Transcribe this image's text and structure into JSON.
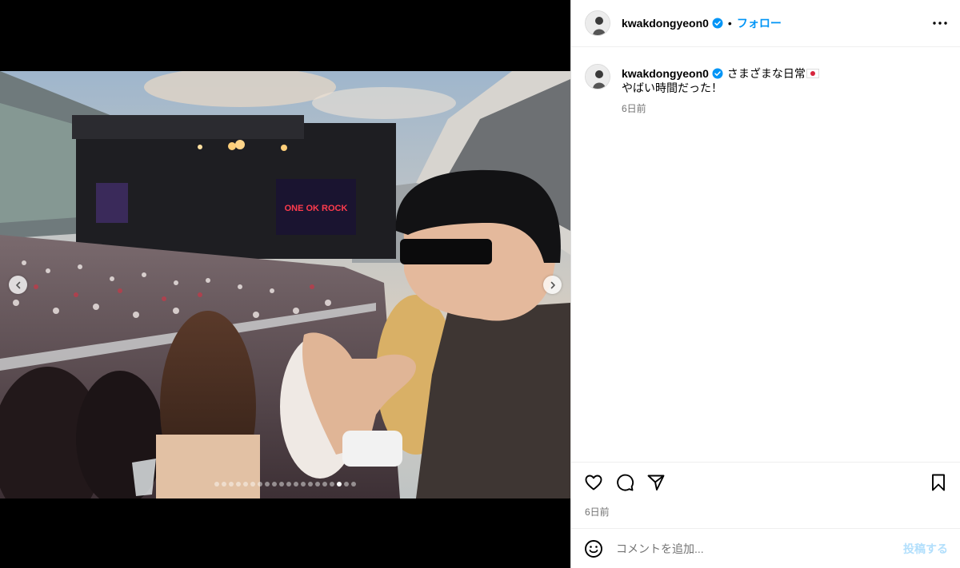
{
  "post": {
    "username": "kwakdongyeon0",
    "verified": true,
    "separator": "•",
    "follow_label": "フォロー",
    "more_icon": "more-horizontal-icon",
    "caption_line1": "さまざまな日常",
    "caption_emoji": "japan-flag-emoji",
    "caption_line2": "やばい時間だった！",
    "caption_time": "6日前",
    "post_time": "6日前"
  },
  "media": {
    "slide_count": 20,
    "active_slide": 18,
    "screen_text": "ONE OK ROCK",
    "prev_icon": "chevron-left-icon",
    "next_icon": "chevron-right-icon"
  },
  "actions": {
    "like_icon": "heart-icon",
    "comment_icon": "comment-icon",
    "share_icon": "send-icon",
    "save_icon": "bookmark-icon"
  },
  "comment": {
    "placeholder": "コメントを追加...",
    "post_label": "投稿する",
    "emoji_icon": "smiley-icon"
  },
  "colors": {
    "accent": "#0095f6",
    "verified": "#0095f6",
    "post_disabled": "#b2dffc",
    "muted": "#737373"
  }
}
